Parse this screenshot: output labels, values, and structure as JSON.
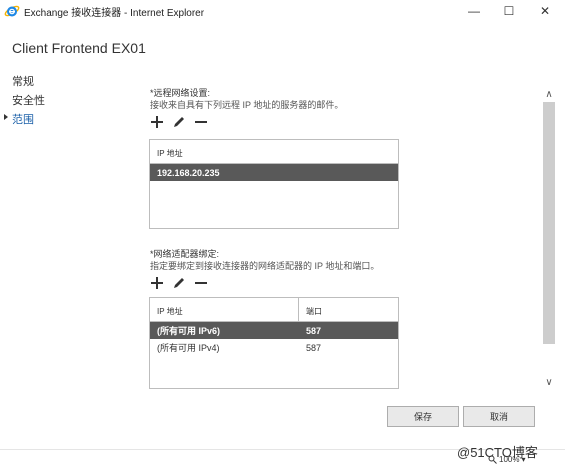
{
  "window": {
    "title": "Exchange 接收连接器 - Internet Explorer",
    "controls": {
      "minimize": "—",
      "maximize": "☐",
      "close": "✕"
    }
  },
  "page": {
    "heading": "Client Frontend EX01"
  },
  "nav": {
    "items": [
      {
        "label": "常规"
      },
      {
        "label": "安全性"
      },
      {
        "label": "范围"
      }
    ],
    "selected": "范围"
  },
  "remote_network": {
    "label": "*远程网络设置:",
    "description": "接收来自具有下列远程 IP 地址的服务器的邮件。",
    "toolbar": [
      "plus-icon",
      "pencil-icon",
      "minus-icon"
    ],
    "column_header": "IP 地址",
    "rows": [
      {
        "ip": "192.168.20.235",
        "selected": true
      }
    ]
  },
  "adapter_bindings": {
    "label": "*网络适配器绑定:",
    "description": "指定要绑定到接收连接器的网络适配器的 IP 地址和端口。",
    "toolbar": [
      "plus-icon",
      "pencil-icon",
      "minus-icon"
    ],
    "columns": [
      "IP 地址",
      "端口"
    ],
    "rows": [
      {
        "ip": "(所有可用 IPv6)",
        "port": "587",
        "selected": true
      },
      {
        "ip": "(所有可用 IPv4)",
        "port": "587",
        "selected": false
      }
    ]
  },
  "buttons": {
    "save": "保存",
    "cancel": "取消"
  },
  "scrollbar": {
    "up": "∧",
    "down": "∨"
  },
  "status": {
    "watermark": "@51CTO博客",
    "zoom": "100%",
    "zoom_arrow": "▾"
  },
  "colors": {
    "selected_row": "#595959",
    "link_blue": "#1a5fa8",
    "ie_blue": "#1e88e5",
    "ie_yellow": "#f5b301"
  }
}
